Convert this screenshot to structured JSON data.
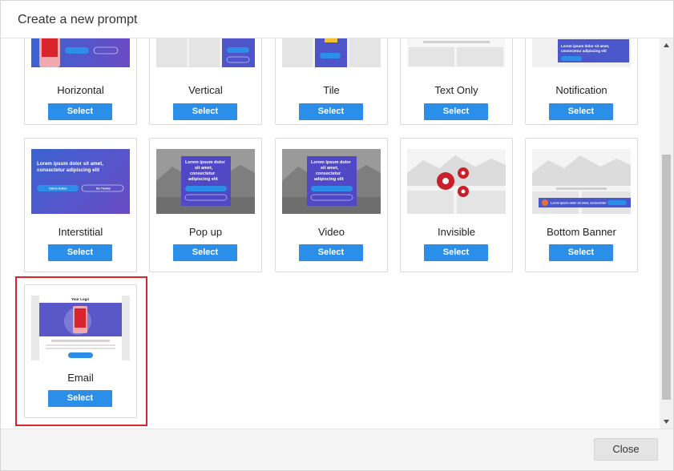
{
  "dialog": {
    "title": "Create a new prompt",
    "close_label": "Close"
  },
  "thumb_text": {
    "lorem": "Lorem ipsum dolor sit amet, consectetur adipiscing elit",
    "lorem_l1": "Lorem ipsum dolor sit amet,",
    "lorem_l2": "consectetur adipiscing elit",
    "popup_l1": "Lorem ipsum dolor",
    "popup_l2": "sit amet,",
    "popup_l3": "consectetur",
    "popup_l4": "adipiscing elit",
    "cta": "Call to Action",
    "no_thanks": "No Thanks",
    "your_logo": "Your Logo",
    "notification_l1": "Lorem ipsum dolor sit amet,",
    "notification_l2": "consectetur adipiscing elit",
    "banner_text": "Lorem ipsum dolor sit amet, consectetur"
  },
  "prompt_types": [
    {
      "label": "Horizontal",
      "select": "Select"
    },
    {
      "label": "Vertical",
      "select": "Select"
    },
    {
      "label": "Tile",
      "select": "Select"
    },
    {
      "label": "Text Only",
      "select": "Select"
    },
    {
      "label": "Notification",
      "select": "Select"
    },
    {
      "label": "Interstitial",
      "select": "Select"
    },
    {
      "label": "Pop up",
      "select": "Select"
    },
    {
      "label": "Video",
      "select": "Select"
    },
    {
      "label": "Invisible",
      "select": "Select"
    },
    {
      "label": "Bottom Banner",
      "select": "Select"
    },
    {
      "label": "Email",
      "select": "Select"
    }
  ],
  "colors": {
    "accent": "#2b8ee8",
    "highlight": "#d9232d",
    "gradient_start": "#3b63d1",
    "gradient_end": "#6a4bc4",
    "gear": "#c8202a"
  }
}
